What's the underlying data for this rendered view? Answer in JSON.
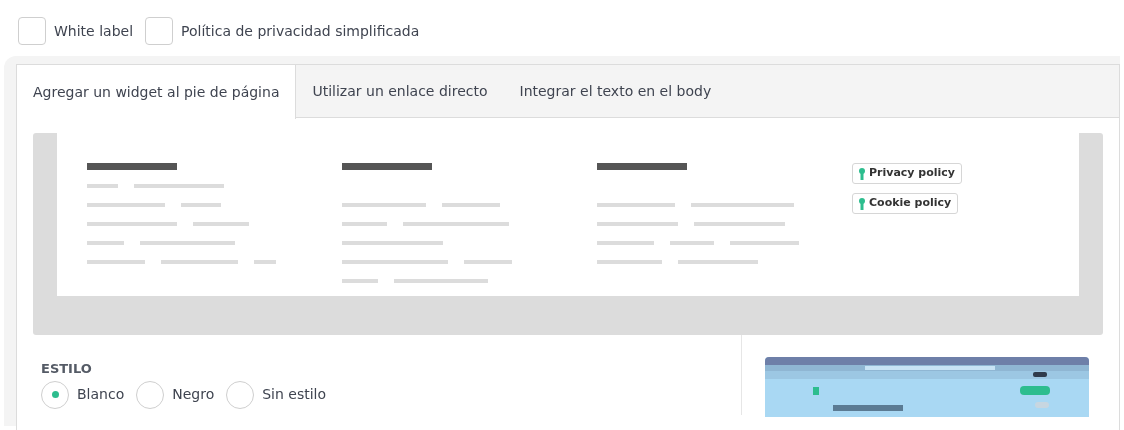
{
  "options": [
    {
      "label": "White label",
      "checked": false
    },
    {
      "label": "Política de privacidad simplificada",
      "checked": false
    }
  ],
  "tabs": [
    {
      "label": "Agregar un widget al pie de página",
      "selected": true
    },
    {
      "label": "Utilizar un enlace directo",
      "selected": false
    },
    {
      "label": "Integrar el texto en el body",
      "selected": false
    }
  ],
  "preview": {
    "badges": [
      "Privacy policy",
      "Cookie policy"
    ]
  },
  "style": {
    "label": "ESTILO",
    "radios": [
      {
        "label": "Blanco",
        "selected": true
      },
      {
        "label": "Negro",
        "selected": false
      },
      {
        "label": "Sin estilo",
        "selected": false
      }
    ]
  }
}
